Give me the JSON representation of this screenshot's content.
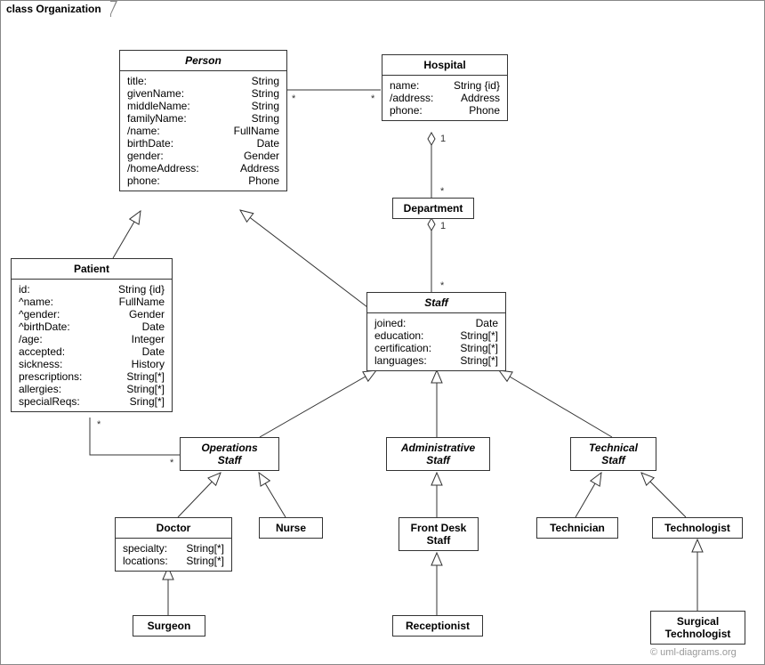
{
  "frame": {
    "title": "class Organization"
  },
  "watermark": "© uml-diagrams.org",
  "classes": {
    "person": {
      "name": "Person",
      "abstract": true,
      "attrs": [
        {
          "name": "title:",
          "type": "String"
        },
        {
          "name": "givenName:",
          "type": "String"
        },
        {
          "name": "middleName:",
          "type": "String"
        },
        {
          "name": "familyName:",
          "type": "String"
        },
        {
          "name": "/name:",
          "type": "FullName"
        },
        {
          "name": "birthDate:",
          "type": "Date"
        },
        {
          "name": "gender:",
          "type": "Gender"
        },
        {
          "name": "/homeAddress:",
          "type": "Address"
        },
        {
          "name": "phone:",
          "type": "Phone"
        }
      ]
    },
    "hospital": {
      "name": "Hospital",
      "abstract": false,
      "attrs": [
        {
          "name": "name:",
          "type": "String {id}"
        },
        {
          "name": "/address:",
          "type": "Address"
        },
        {
          "name": "phone:",
          "type": "Phone"
        }
      ]
    },
    "department": {
      "name": "Department",
      "abstract": false
    },
    "patient": {
      "name": "Patient",
      "abstract": false,
      "attrs": [
        {
          "name": "id:",
          "type": "String {id}"
        },
        {
          "name": "^name:",
          "type": "FullName"
        },
        {
          "name": "^gender:",
          "type": "Gender"
        },
        {
          "name": "^birthDate:",
          "type": "Date"
        },
        {
          "name": "/age:",
          "type": "Integer"
        },
        {
          "name": "accepted:",
          "type": "Date"
        },
        {
          "name": "sickness:",
          "type": "History"
        },
        {
          "name": "prescriptions:",
          "type": "String[*]"
        },
        {
          "name": "allergies:",
          "type": "String[*]"
        },
        {
          "name": "specialReqs:",
          "type": "Sring[*]"
        }
      ]
    },
    "staff": {
      "name": "Staff",
      "abstract": true,
      "attrs": [
        {
          "name": "joined:",
          "type": "Date"
        },
        {
          "name": "education:",
          "type": "String[*]"
        },
        {
          "name": "certification:",
          "type": "String[*]"
        },
        {
          "name": "languages:",
          "type": "String[*]"
        }
      ]
    },
    "operationsStaff": {
      "name": "Operations\nStaff",
      "abstract": true
    },
    "administrativeStaff": {
      "name": "Administrative\nStaff",
      "abstract": true
    },
    "technicalStaff": {
      "name": "Technical\nStaff",
      "abstract": true
    },
    "doctor": {
      "name": "Doctor",
      "abstract": false,
      "attrs": [
        {
          "name": "specialty:",
          "type": "String[*]"
        },
        {
          "name": "locations:",
          "type": "String[*]"
        }
      ]
    },
    "nurse": {
      "name": "Nurse",
      "abstract": false
    },
    "frontDesk": {
      "name": "Front Desk\nStaff",
      "abstract": false
    },
    "technician": {
      "name": "Technician",
      "abstract": false
    },
    "technologist": {
      "name": "Technologist",
      "abstract": false
    },
    "surgeon": {
      "name": "Surgeon",
      "abstract": false
    },
    "receptionist": {
      "name": "Receptionist",
      "abstract": false
    },
    "surgTech": {
      "name": "Surgical\nTechnologist",
      "abstract": false
    }
  },
  "multiplicities": {
    "person_hospital_left": "*",
    "person_hospital_right": "*",
    "hospital_department_one": "1",
    "hospital_department_many": "*",
    "department_staff_one": "1",
    "department_staff_many": "*",
    "patient_opstaff_left": "*",
    "patient_opstaff_right": "*"
  }
}
